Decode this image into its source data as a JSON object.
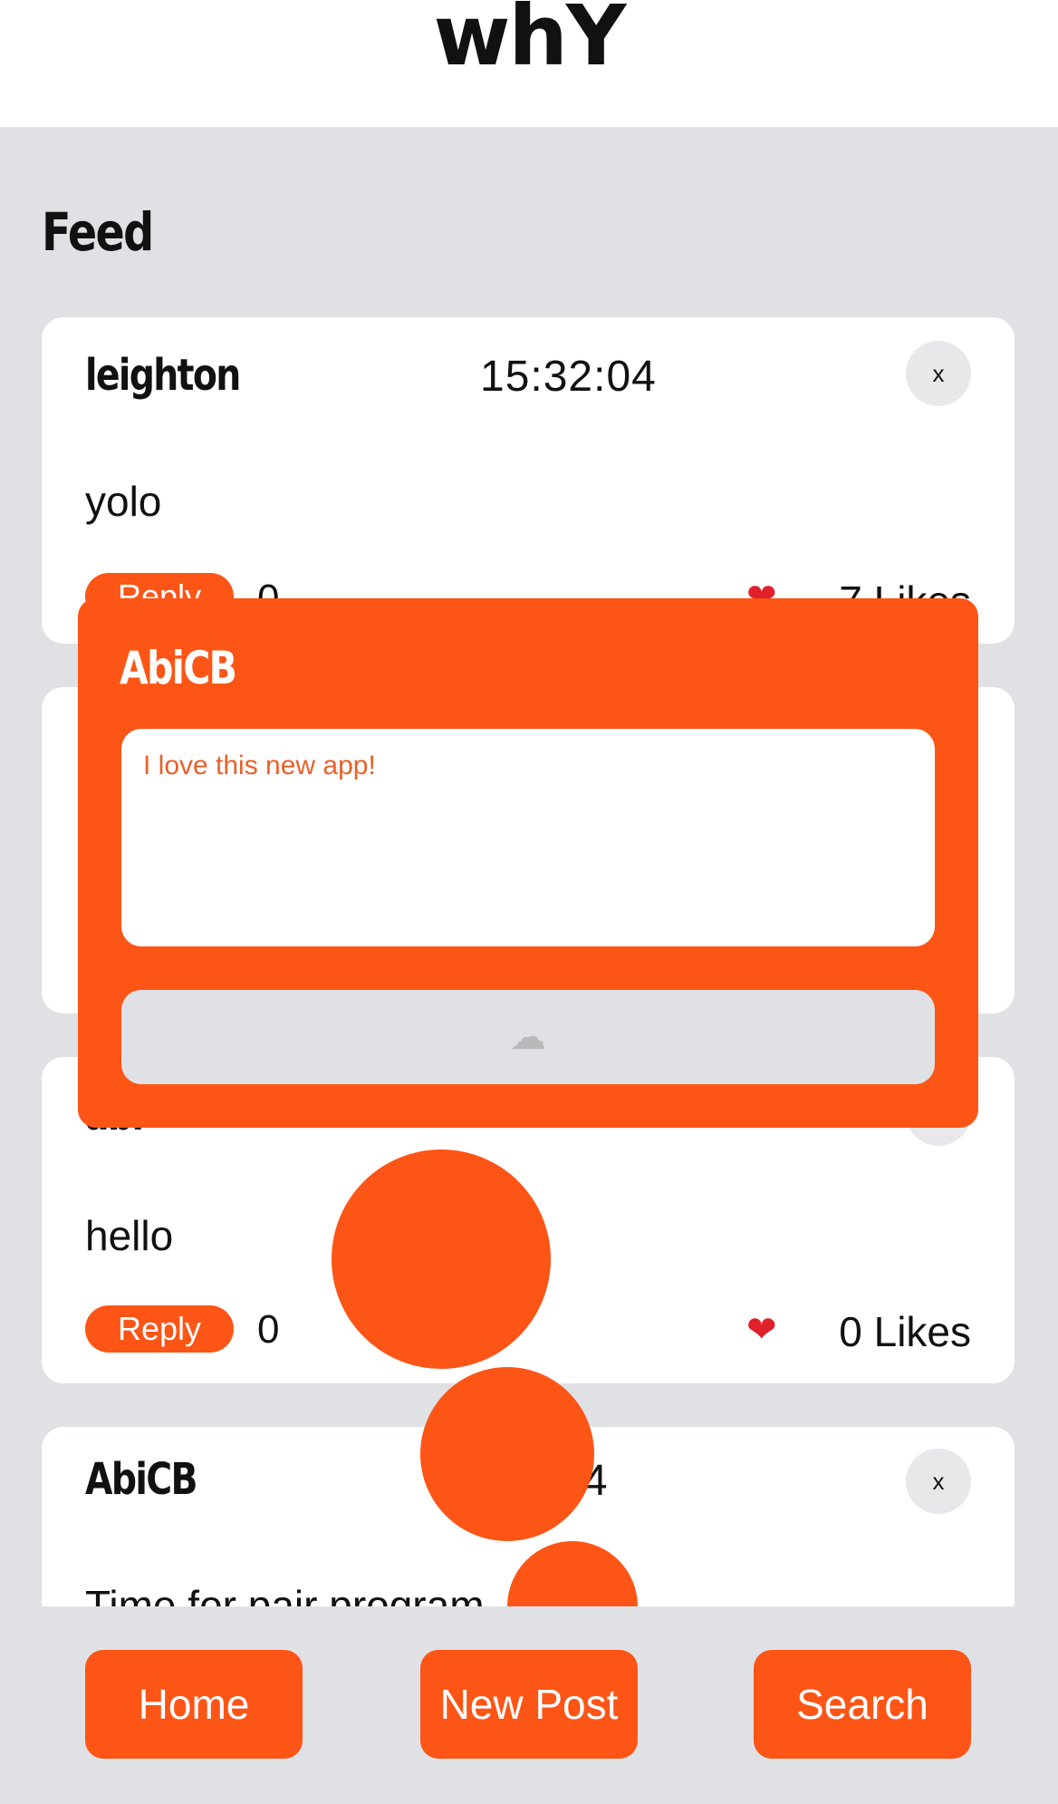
{
  "app": {
    "title": "whY"
  },
  "feed": {
    "title": "Feed",
    "close_label": "x",
    "reply_label": "Reply",
    "heart_icon": "heart-icon",
    "posts": [
      {
        "user": "leighton",
        "time": "15:32:04",
        "content": "yolo",
        "replies": "0",
        "likes": "7 Likes"
      },
      {
        "user": "",
        "time": "",
        "content": "",
        "replies": "",
        "likes": ""
      },
      {
        "user": "abi",
        "time": "",
        "content": "hello",
        "replies": "0",
        "likes": "0 Likes"
      },
      {
        "user": "AbiCB",
        "time": "14",
        "content": "Time for pair program",
        "replies": "",
        "likes": ""
      }
    ]
  },
  "modal": {
    "user": "AbiCB",
    "input_value": "I love this new app!",
    "submit_icon": "thought-bubble-icon"
  },
  "nav": {
    "home": "Home",
    "new_post": "New Post",
    "search": "Search"
  },
  "colors": {
    "accent": "#fc5516",
    "background": "#e0e1e5",
    "card": "#ffffff"
  }
}
